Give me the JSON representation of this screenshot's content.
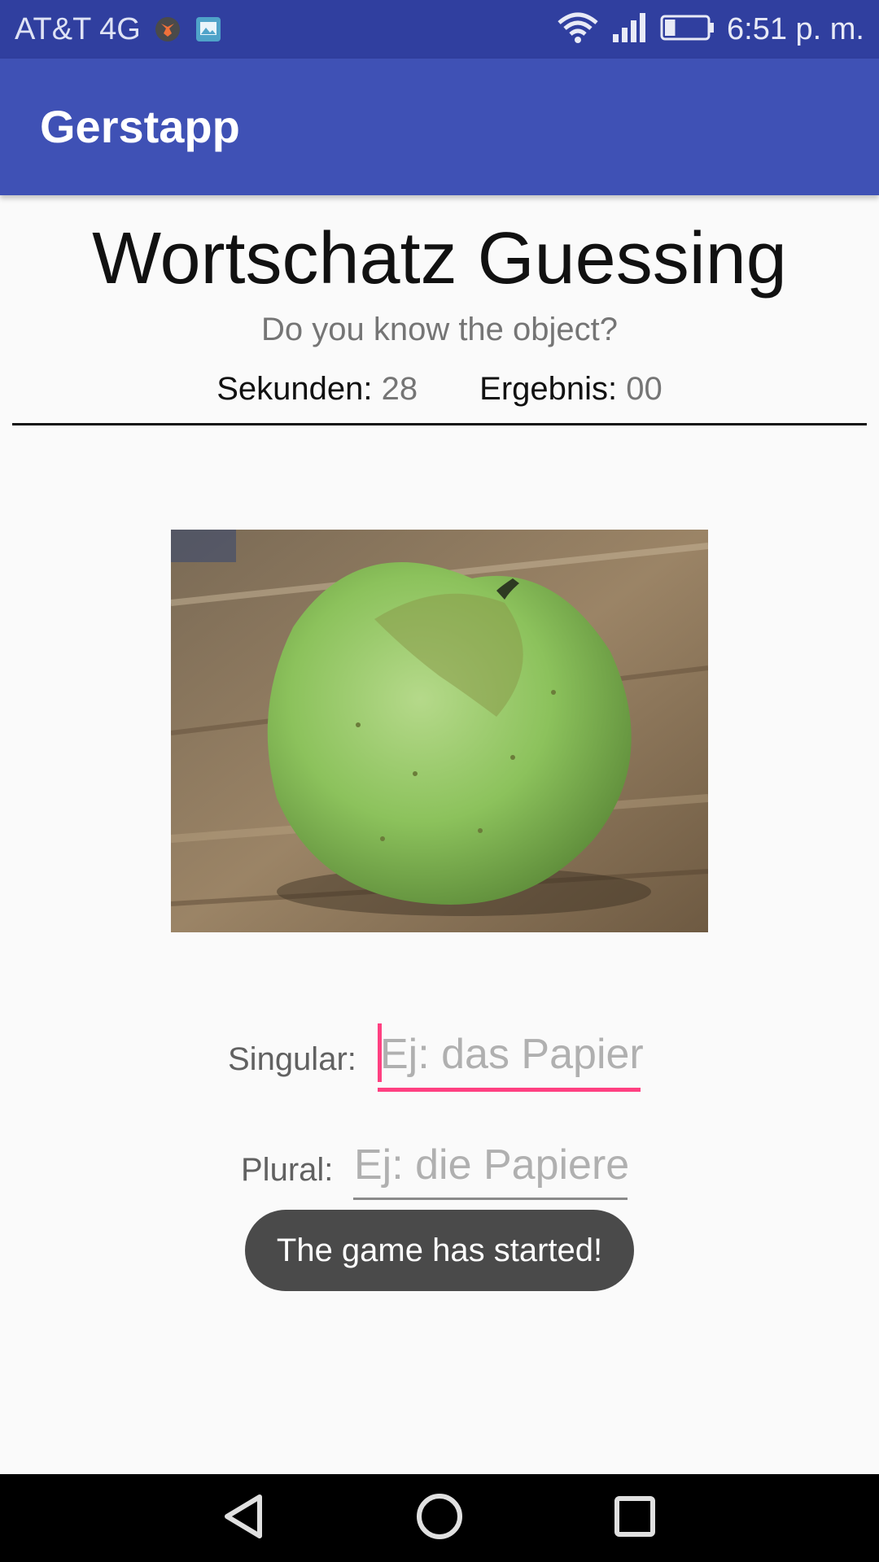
{
  "status_bar": {
    "carrier": "AT&T 4G",
    "time": "6:51 p. m.",
    "icons": [
      "fox-notification-icon",
      "gallery-notification-icon",
      "wifi-icon",
      "signal-icon",
      "battery-icon"
    ],
    "battery_level": 0.25
  },
  "app_bar": {
    "title": "Gerstapp"
  },
  "game": {
    "title": "Wortschatz Guessing",
    "subtitle": "Do you know the object?",
    "seconds_label": "Sekunden:",
    "seconds_value": "28",
    "score_label": "Ergebnis:",
    "score_value": "00"
  },
  "form": {
    "singular_label": "Singular:",
    "singular_placeholder": "Ej: das Papier",
    "plural_label": "Plural:",
    "plural_placeholder": "Ej: die Papiere"
  },
  "toast": {
    "message": "The game has started!"
  },
  "nav": {
    "icons": [
      "back-icon",
      "home-icon",
      "recents-icon"
    ]
  },
  "colors": {
    "status_bar": "#303f9f",
    "app_bar": "#3f51b5",
    "accent": "#ff4081",
    "toast": "#4a4a4a"
  }
}
